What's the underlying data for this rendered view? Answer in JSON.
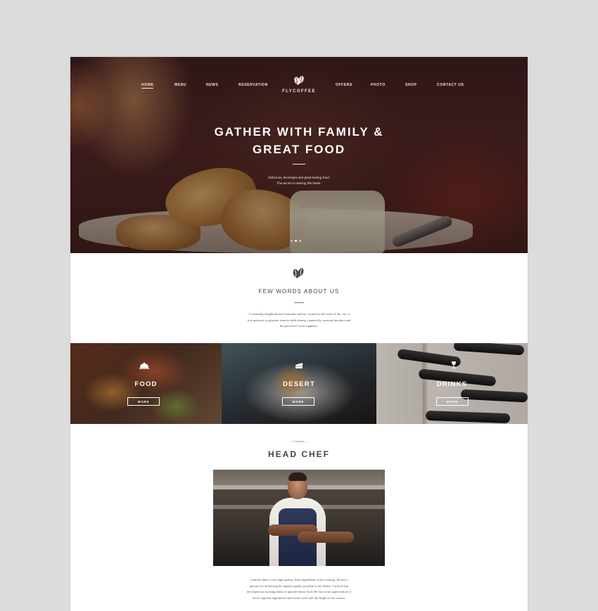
{
  "brand": {
    "name": "FLYCOFFEE",
    "icon": "coffee-bean-icon"
  },
  "nav": {
    "items": [
      {
        "label": "HOME",
        "active": true
      },
      {
        "label": "MENU"
      },
      {
        "label": "NEWS"
      },
      {
        "label": "RESERVATION"
      },
      {
        "label": "OFFERS"
      },
      {
        "label": "PHOTO"
      },
      {
        "label": "SHOP"
      },
      {
        "label": "CONTACT US"
      }
    ]
  },
  "hero": {
    "title_line1": "GATHER WITH FAMILY &",
    "title_line2": "GREAT FOOD",
    "subtitle_line1": "Delicious, beverages and great-tasting food.",
    "subtitle_line2": "The secret to making life better.",
    "slides": 3,
    "active_slide": 1
  },
  "about": {
    "icon": "coffee-bean-icon",
    "title": "FEW WORDS ABOUT US",
    "text_lines": [
      "A charming neighborhood restaurant and bar, located in the heart of the city; a",
      "true gateway to gourmet farm-to-table dining, inspired by seasonal produce and",
      "the province's local suppliers."
    ]
  },
  "categories": [
    {
      "label": "FOOD",
      "button": "MORE",
      "icon": "cloche-icon"
    },
    {
      "label": "DESERT",
      "button": "MORE",
      "icon": "cake-icon"
    },
    {
      "label": "DRINKS",
      "button": "MORE",
      "icon": "wine-glass-icon"
    }
  ],
  "chef": {
    "kicker": "— Carmelo —",
    "title": "HEAD CHEF",
    "text_lines": [
      "Carmelo likes to use high quality, fresh ingredients in his cooking. He has a",
      "passion for delivering the highest quality possible in his dishes. Carmelo has",
      "developed an exciting menu of upscale bistro food. He has a true appreciation of",
      "fresh, regional ingredients and works well with the height of the season."
    ]
  },
  "colors": {
    "background": "#dcdcdc",
    "page": "#ffffff",
    "heading": "#444444",
    "body_text": "#555555"
  }
}
